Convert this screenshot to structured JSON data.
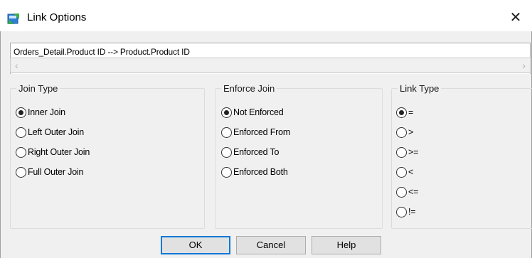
{
  "window": {
    "title": "Link Options"
  },
  "link": {
    "expression": "Orders_Detail.Product ID --> Product.Product ID"
  },
  "join_type": {
    "title": "Join Type",
    "options": [
      "Inner Join",
      "Left Outer Join",
      "Right Outer Join",
      "Full Outer Join"
    ],
    "selected": "Inner Join"
  },
  "enforce_join": {
    "title": "Enforce Join",
    "options": [
      "Not Enforced",
      "Enforced From",
      "Enforced To",
      "Enforced Both"
    ],
    "selected": "Not Enforced"
  },
  "link_type": {
    "title": "Link Type",
    "options": [
      "=",
      ">",
      ">=",
      "<",
      "<=",
      "!="
    ],
    "selected": "="
  },
  "buttons": {
    "ok": "OK",
    "cancel": "Cancel",
    "help": "Help"
  },
  "icons": {
    "app": "link-options-app-icon",
    "close": "close-icon"
  }
}
